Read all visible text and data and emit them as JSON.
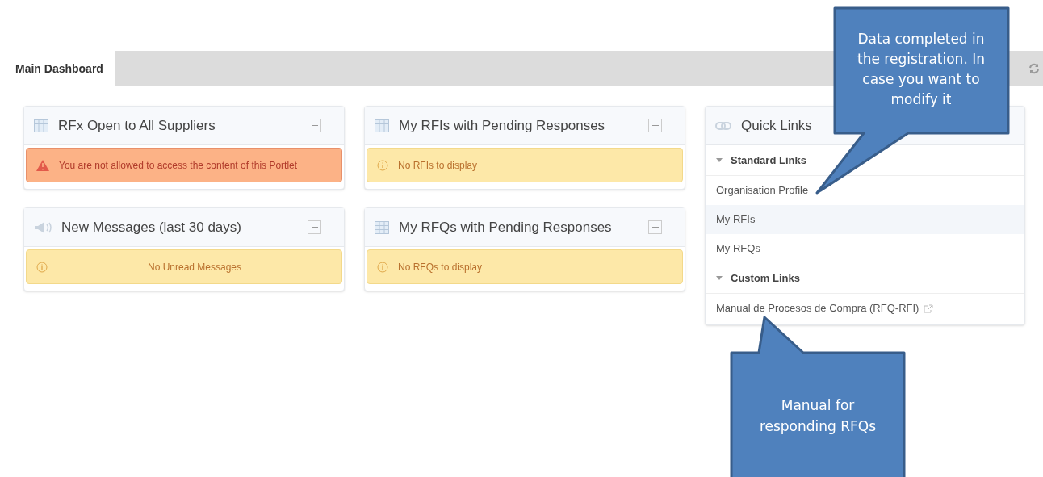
{
  "tabs": [
    {
      "label": "Main Dashboard",
      "selected": true
    }
  ],
  "columns": [
    {
      "portlets": [
        {
          "title": "RFx Open to All Suppliers",
          "kind": "table",
          "alert": {
            "kind": "error",
            "text": "You are not allowed to access the content of this Portlet",
            "centered": false
          }
        },
        {
          "title": "New Messages (last 30 days)",
          "kind": "messages",
          "alert": {
            "kind": "warning",
            "text": "No Unread Messages",
            "centered": true
          }
        }
      ]
    },
    {
      "portlets": [
        {
          "title": "My RFIs with Pending Responses",
          "kind": "table",
          "alert": {
            "kind": "warning",
            "text": "No RFIs to display",
            "centered": false
          }
        },
        {
          "title": "My RFQs with Pending Responses",
          "kind": "table",
          "alert": {
            "kind": "warning",
            "text": "No RFQs to display",
            "centered": false
          }
        }
      ]
    }
  ],
  "quick_links": {
    "title": "Quick Links",
    "groups": [
      {
        "label": "Standard Links",
        "expanded": true,
        "items": [
          {
            "label": "Organisation Profile",
            "selected": false,
            "external": false
          },
          {
            "label": "My RFIs",
            "selected": true,
            "external": false
          },
          {
            "label": "My RFQs",
            "selected": false,
            "external": false
          }
        ]
      },
      {
        "label": "Custom Links",
        "expanded": true,
        "items": [
          {
            "label": "Manual de Procesos de Compra (RFQ-RFI)",
            "selected": false,
            "external": true
          }
        ]
      }
    ]
  },
  "callouts": [
    {
      "text": "Data completed in the registration. In case you want to modify it"
    },
    {
      "text": "Manual for responding RFQs"
    }
  ]
}
